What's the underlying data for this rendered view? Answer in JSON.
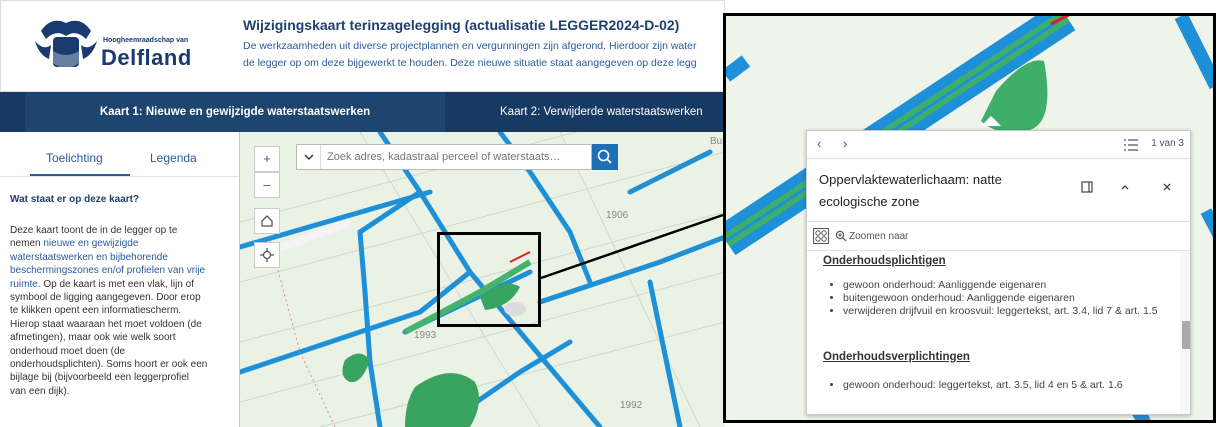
{
  "header": {
    "logo_small": "Hoogheemraadschap van",
    "logo_big": "Delfland",
    "title": "Wijzigingskaart terinzagelegging (actualisatie LEGGER2024-D-02)",
    "desc_line1": "De werkzaamheden uit diverse projectplannen en vergunningen zijn afgerond. Hierdoor zijn water",
    "desc_line2": "de legger op om deze bijgewerkt te houden. Deze nieuwe situatie staat aangegeven op deze legg"
  },
  "tabs": {
    "tab1": "Kaart 1: Nieuwe en gewijzigde waterstaatswerken",
    "tab2": "Kaart 2: Verwijderde waterstaatswerken"
  },
  "panel": {
    "tab_toelichting": "Toelichting",
    "tab_legenda": "Legenda",
    "heading": "Wat staat er op deze kaart?",
    "p1": "Deze kaart toont de in de legger op te",
    "p2": "nemen",
    "link1": "nieuwe en gewijzigde",
    "link2": "waterstaatswerken en bijbehorende",
    "link3": "beschermingszones en/of profielen van vrije",
    "link4": "ruimte",
    "p3": ". Op de kaart is met een vlak, lijn of",
    "p4": "symbool de ligging aangegeven. Door erop",
    "p5": "te klikken opent een informatiescherm.",
    "p6": "Hierop staat waaraan het moet voldoen (de",
    "p7": "afmetingen), maar ook wie welk soort",
    "p8": "onderhoud moet doen (de",
    "p9": "onderhoudsplichten). Soms hoort er ook een",
    "p10": "bijlage bij (bijvoorbeeld een leggerprofiel",
    "p11": "van een dijk)."
  },
  "map": {
    "zoom_in": "+",
    "zoom_out": "–",
    "search_placeholder": "Zoek adres, kadastraal perceel of waterstaats…",
    "label_1906": "1906",
    "label_1993": "1993",
    "label_1992": "1992",
    "label_b": "Bu"
  },
  "popup": {
    "prev": "‹",
    "next": "›",
    "count": "1 van 3",
    "title_line1": "Oppervlaktewaterlichaam: natte",
    "title_line2": "ecologische zone",
    "zoom_label": "Zoomen naar",
    "h1": "Onderhoudsplichtigen",
    "list1": [
      "gewoon onderhoud: Aanliggende eigenaren",
      "buitengewoon onderhoud: Aanliggende eigenaren",
      "verwijderen drijfvuil en kroosvuil: leggertekst, art. 3.4, lid 7 & art. 1.5"
    ],
    "h2": "Onderhoudsverplichtingen",
    "list2": [
      "gewoon onderhoud: leggertekst, art. 3.5, lid 4 en 5 & art. 1.6"
    ]
  },
  "colors": {
    "brand": "#1a3b6f",
    "tabbar": "#173a63",
    "water": "#1e90d8",
    "eco": "#3fae6a",
    "link": "#2a5b9a"
  }
}
